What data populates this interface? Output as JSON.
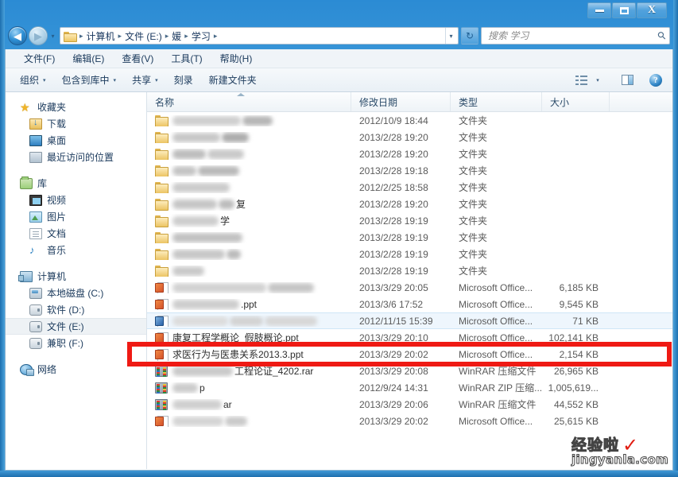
{
  "window": {
    "minimize_label": "–",
    "maximize_label": "□",
    "close_label": "X"
  },
  "nav": {
    "back_label": "◀",
    "forward_label": "▶",
    "history_label": "▾",
    "refresh_label": "↻",
    "crumb_chevron": "▾",
    "breadcrumb": [
      "计算机",
      "文件 (E:)",
      "媛",
      "学习"
    ],
    "separator": "▸"
  },
  "search": {
    "placeholder": "搜索 学习",
    "value": "",
    "icon": "search-icon",
    "glyph": "⚲"
  },
  "menubar": {
    "items": [
      {
        "label": "文件(F)"
      },
      {
        "label": "编辑(E)"
      },
      {
        "label": "查看(V)"
      },
      {
        "label": "工具(T)"
      },
      {
        "label": "帮助(H)"
      }
    ]
  },
  "toolbar": {
    "items": [
      {
        "label": "组织",
        "caret": "▾"
      },
      {
        "label": "包含到库中",
        "caret": "▾"
      },
      {
        "label": "共享",
        "caret": "▾"
      },
      {
        "label": "刻录",
        "caret": ""
      },
      {
        "label": "新建文件夹",
        "caret": ""
      }
    ],
    "view_caret": "▾",
    "help_label": "?"
  },
  "sidebar": {
    "groups": [
      {
        "header": {
          "label": "收藏夹",
          "icon": "star-icon"
        },
        "items": [
          {
            "label": "下载",
            "icon": "downloads-icon"
          },
          {
            "label": "桌面",
            "icon": "desktop-icon"
          },
          {
            "label": "最近访问的位置",
            "icon": "recent-places-icon"
          }
        ]
      },
      {
        "header": {
          "label": "库",
          "icon": "library-icon"
        },
        "items": [
          {
            "label": "视频",
            "icon": "videos-icon"
          },
          {
            "label": "图片",
            "icon": "pictures-icon"
          },
          {
            "label": "文档",
            "icon": "documents-icon"
          },
          {
            "label": "音乐",
            "icon": "music-icon"
          }
        ]
      },
      {
        "header": {
          "label": "计算机",
          "icon": "computer-icon"
        },
        "items": [
          {
            "label": "本地磁盘 (C:)",
            "icon": "hdd-icon",
            "selected": false
          },
          {
            "label": "软件 (D:)",
            "icon": "drive-icon",
            "selected": false
          },
          {
            "label": "文件 (E:)",
            "icon": "drive-icon",
            "selected": true
          },
          {
            "label": "兼职 (F:)",
            "icon": "drive-icon",
            "selected": false
          }
        ]
      },
      {
        "header": {
          "label": "网络",
          "icon": "network-icon"
        },
        "items": []
      }
    ]
  },
  "filelist": {
    "columns": [
      {
        "label": "名称",
        "key": "name",
        "sorted": true
      },
      {
        "label": "修改日期",
        "key": "date"
      },
      {
        "label": "类型",
        "key": "type"
      },
      {
        "label": "大小",
        "key": "size"
      }
    ],
    "rows": [
      {
        "name": "",
        "redacted": true,
        "icon": "folder-icon",
        "date": "2012/10/9 18:44",
        "type": "文件夹",
        "size": ""
      },
      {
        "name": "",
        "redacted": true,
        "icon": "folder-icon",
        "date": "2013/2/28 19:20",
        "type": "文件夹",
        "size": ""
      },
      {
        "name": "",
        "redacted": true,
        "icon": "folder-icon",
        "date": "2013/2/28 19:20",
        "type": "文件夹",
        "size": ""
      },
      {
        "name": "",
        "redacted": true,
        "icon": "folder-icon",
        "date": "2013/2/28 19:18",
        "type": "文件夹",
        "size": ""
      },
      {
        "name": "",
        "redacted": true,
        "icon": "folder-icon",
        "date": "2012/2/25 18:58",
        "type": "文件夹",
        "size": ""
      },
      {
        "name": "复",
        "redacted": true,
        "icon": "folder-icon",
        "date": "2013/2/28 19:20",
        "type": "文件夹",
        "size": ""
      },
      {
        "name": "学",
        "redacted": true,
        "icon": "folder-icon",
        "date": "2013/2/28 19:19",
        "type": "文件夹",
        "size": ""
      },
      {
        "name": "",
        "redacted": true,
        "icon": "folder-icon",
        "date": "2013/2/28 19:19",
        "type": "文件夹",
        "size": ""
      },
      {
        "name": "",
        "redacted": true,
        "icon": "folder-icon",
        "date": "2013/2/28 19:19",
        "type": "文件夹",
        "size": ""
      },
      {
        "name": "",
        "redacted": true,
        "icon": "folder-icon",
        "date": "2013/2/28 19:19",
        "type": "文件夹",
        "size": ""
      },
      {
        "name": "",
        "redacted": true,
        "icon": "ppt-icon",
        "date": "2013/3/29 20:05",
        "type": "Microsoft Office...",
        "size": "6,185 KB"
      },
      {
        "name": ".ppt",
        "redacted": true,
        "icon": "ppt-icon",
        "date": "2013/3/6 17:52",
        "type": "Microsoft Office...",
        "size": "9,545 KB"
      },
      {
        "name": "",
        "redacted": true,
        "icon": "docx-icon",
        "date": "2012/11/15 15:39",
        "type": "Microsoft Office...",
        "size": "71 KB",
        "hover": true
      },
      {
        "name": "康复工程学概论_假肢概论.ppt",
        "redacted": false,
        "icon": "ppt-icon",
        "date": "2013/3/29 20:10",
        "type": "Microsoft Office...",
        "size": "102,141 KB"
      },
      {
        "name": "求医行为与医患关系2013.3.ppt",
        "redacted": false,
        "icon": "ppt-icon",
        "date": "2013/3/29 20:02",
        "type": "Microsoft Office...",
        "size": "2,154 KB",
        "highlighted": true
      },
      {
        "name": "工程论证_4202.rar",
        "redacted": true,
        "icon": "rar-icon",
        "date": "2013/3/29 20:08",
        "type": "WinRAR 压缩文件",
        "size": "26,965 KB"
      },
      {
        "name": "p",
        "redacted": true,
        "icon": "rar-icon",
        "date": "2012/9/24 14:31",
        "type": "WinRAR ZIP 压缩...",
        "size": "1,005,619..."
      },
      {
        "name": "ar",
        "redacted": true,
        "icon": "rar-icon",
        "date": "2013/3/29 20:06",
        "type": "WinRAR 压缩文件",
        "size": "44,552 KB"
      },
      {
        "name": "",
        "redacted": true,
        "icon": "ppt-icon",
        "date": "2013/3/29 20:02",
        "type": "Microsoft Office...",
        "size": "25,615 KB"
      }
    ]
  },
  "annotation": {
    "color": "#ef1a14",
    "target_row_name": "求医行为与医患关系2013.3.ppt"
  },
  "watermark": {
    "brand": "经验啦",
    "check": "✓",
    "url": "jingyanla.com"
  }
}
